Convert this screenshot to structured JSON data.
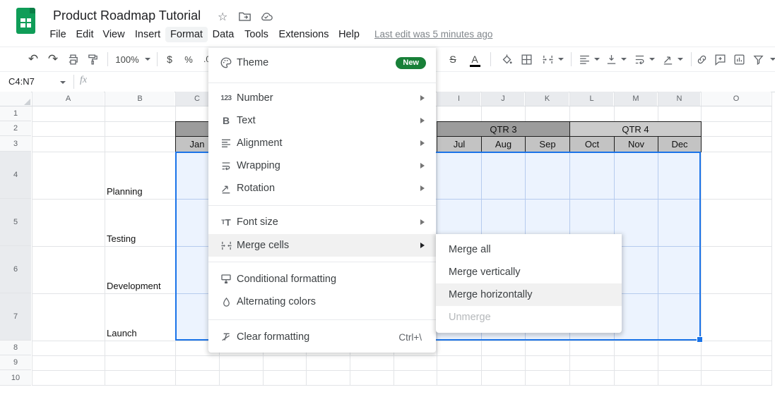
{
  "header": {
    "title": "Product Roadmap Tutorial",
    "icons": [
      "star",
      "move-to-folder",
      "cloud-saved"
    ]
  },
  "menubar": {
    "items": [
      "File",
      "Edit",
      "View",
      "Insert",
      "Format",
      "Data",
      "Tools",
      "Extensions",
      "Help"
    ],
    "active_item": "Format",
    "last_edit": "Last edit was 5 minutes ago"
  },
  "toolbar": {
    "zoom_value": "100%",
    "currency": "$",
    "percent": "%",
    "decimal": ".0",
    "strikethrough_glyph": "S",
    "text_color_glyph": "A"
  },
  "formula_bar": {
    "range": "C4:N7",
    "fx": "fx",
    "value": ""
  },
  "grid": {
    "columns": [
      "A",
      "B",
      "C",
      "I",
      "J",
      "K",
      "L",
      "M",
      "N",
      "O"
    ],
    "rows": [
      "1",
      "2",
      "3",
      "4",
      "5",
      "6",
      "7",
      "8",
      "9",
      "10"
    ],
    "tasks": [
      "Planning",
      "Testing",
      "Development",
      "Launch"
    ],
    "q3": "QTR 3",
    "q4": "QTR 4",
    "jan": "Jan",
    "months": [
      "Jul",
      "Aug",
      "Sep",
      "Oct",
      "Nov",
      "Dec"
    ],
    "selection_range": "C4:N7"
  },
  "format_menu": {
    "theme_label": "Theme",
    "new_badge": "New",
    "icon_glyphs": {
      "number": "123",
      "text": "B",
      "font_size": "TT"
    },
    "items": [
      {
        "label": "Number"
      },
      {
        "label": "Text"
      },
      {
        "label": "Alignment"
      },
      {
        "label": "Wrapping"
      },
      {
        "label": "Rotation"
      },
      {
        "label": "Font size"
      },
      {
        "label": "Merge cells"
      },
      {
        "label": "Conditional formatting"
      },
      {
        "label": "Alternating colors"
      },
      {
        "label": "Clear formatting",
        "shortcut": "Ctrl+\\"
      }
    ],
    "highlighted_item": "Merge cells"
  },
  "merge_submenu": {
    "items": [
      "Merge all",
      "Merge vertically",
      "Merge horizontally",
      "Unmerge"
    ],
    "highlighted_item": "Merge horizontally",
    "disabled_item": "Unmerge"
  },
  "colors": {
    "accent_blue": "#1a73e8",
    "selection_fill": "#e8f0fe",
    "qtr3_bg": "#9c9c9c",
    "qtr4_bg": "#cbcbcb",
    "month_bg": "#c3c3c3",
    "badge_green": "#188038",
    "logo_green": "#0f9d58"
  }
}
